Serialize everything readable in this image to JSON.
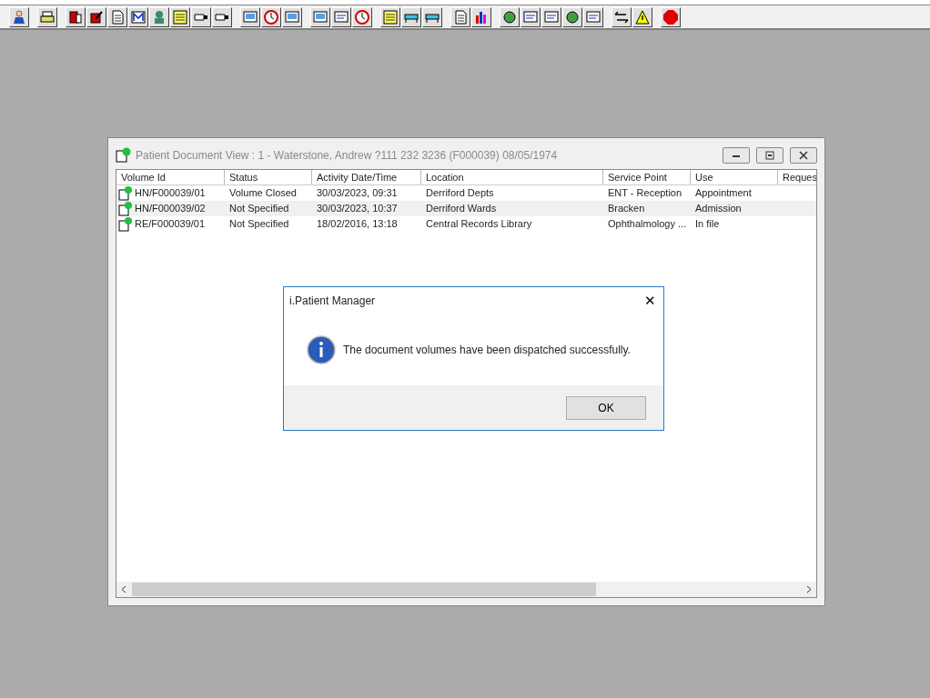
{
  "document_window": {
    "title": "Patient Document View : 1 - Waterstone, Andrew ?111 232 3236 (F000039) 08/05/1974",
    "active": false
  },
  "table": {
    "columns": [
      "Volume Id",
      "Status",
      "Activity Date/Time",
      "Location",
      "Service Point",
      "Use",
      "Reques"
    ],
    "rows": [
      {
        "cells": [
          "HN/F000039/01",
          "Volume Closed",
          "30/03/2023, 09:31",
          "Derriford Depts",
          "ENT - Reception",
          "Appointment",
          ""
        ]
      },
      {
        "cells": [
          "HN/F000039/02",
          "Not Specified",
          "30/03/2023, 10:37",
          "Derriford Wards",
          "Bracken",
          "Admission",
          ""
        ]
      },
      {
        "cells": [
          "RE/F000039/01",
          "Not Specified",
          "18/02/2016, 13:18",
          "Central Records Library",
          "Ophthalmology ...",
          "In file",
          ""
        ]
      }
    ]
  },
  "dialog": {
    "title": "i.Patient Manager",
    "close": "✕",
    "message": "The document volumes have been dispatched successfully.",
    "buttons": [
      "OK"
    ]
  }
}
